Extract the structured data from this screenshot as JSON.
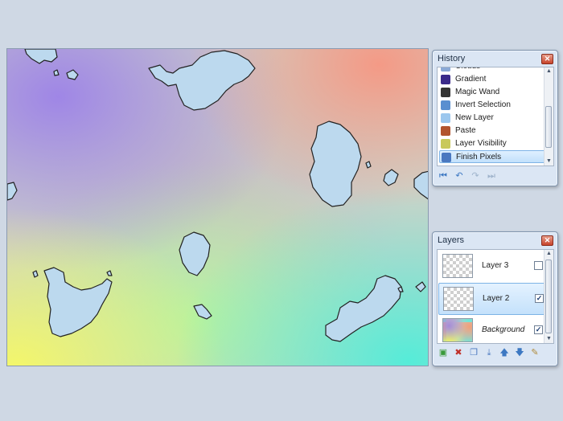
{
  "canvas": {
    "name": "image-canvas"
  },
  "history": {
    "title": "History",
    "close_glyph": "✕",
    "items": [
      {
        "label": "Clouds",
        "icon": "clouds-icon",
        "color": "#8aa9d6"
      },
      {
        "label": "Gradient",
        "icon": "gradient-icon",
        "color": "#3a2a8a"
      },
      {
        "label": "Magic Wand",
        "icon": "magic-wand-icon",
        "color": "#333333"
      },
      {
        "label": "Invert Selection",
        "icon": "invert-selection-icon",
        "color": "#5a8fd0"
      },
      {
        "label": "New Layer",
        "icon": "new-layer-icon",
        "color": "#9cc7ee"
      },
      {
        "label": "Paste",
        "icon": "paste-icon",
        "color": "#b2542e"
      },
      {
        "label": "Layer Visibility",
        "icon": "layer-visibility-icon",
        "color": "#c9c95a"
      },
      {
        "label": "Finish Pixels",
        "icon": "finish-pixels-icon",
        "color": "#4a78c0"
      }
    ],
    "toolbar": [
      {
        "name": "rewind-button",
        "glyph": "⏮",
        "dim": false
      },
      {
        "name": "undo-button",
        "glyph": "↶",
        "dim": false
      },
      {
        "name": "redo-button",
        "glyph": "↷",
        "dim": true
      },
      {
        "name": "fast-forward-button",
        "glyph": "⏭",
        "dim": true
      }
    ]
  },
  "layers": {
    "title": "Layers",
    "close_glyph": "✕",
    "items": [
      {
        "name": "Layer 3",
        "visible": false,
        "selected": false,
        "italic": false,
        "background": false
      },
      {
        "name": "Layer 2",
        "visible": true,
        "selected": true,
        "italic": false,
        "background": false
      },
      {
        "name": "Background",
        "visible": true,
        "selected": false,
        "italic": true,
        "background": true
      }
    ],
    "toolbar": [
      {
        "name": "add-layer-button",
        "glyph": "▣",
        "color": "#3a9a3a"
      },
      {
        "name": "delete-layer-button",
        "glyph": "✖",
        "color": "#c0302a"
      },
      {
        "name": "duplicate-layer-button",
        "glyph": "❐",
        "color": "#4a78c0"
      },
      {
        "name": "merge-layer-down-button",
        "glyph": "⤓",
        "color": "#4a78c0"
      },
      {
        "name": "move-layer-up-button",
        "glyph": "🡅",
        "color": "#3d78c2"
      },
      {
        "name": "move-layer-down-button",
        "glyph": "🡇",
        "color": "#3d78c2"
      },
      {
        "name": "layer-properties-button",
        "glyph": "✎",
        "color": "#b08a3a"
      }
    ]
  }
}
